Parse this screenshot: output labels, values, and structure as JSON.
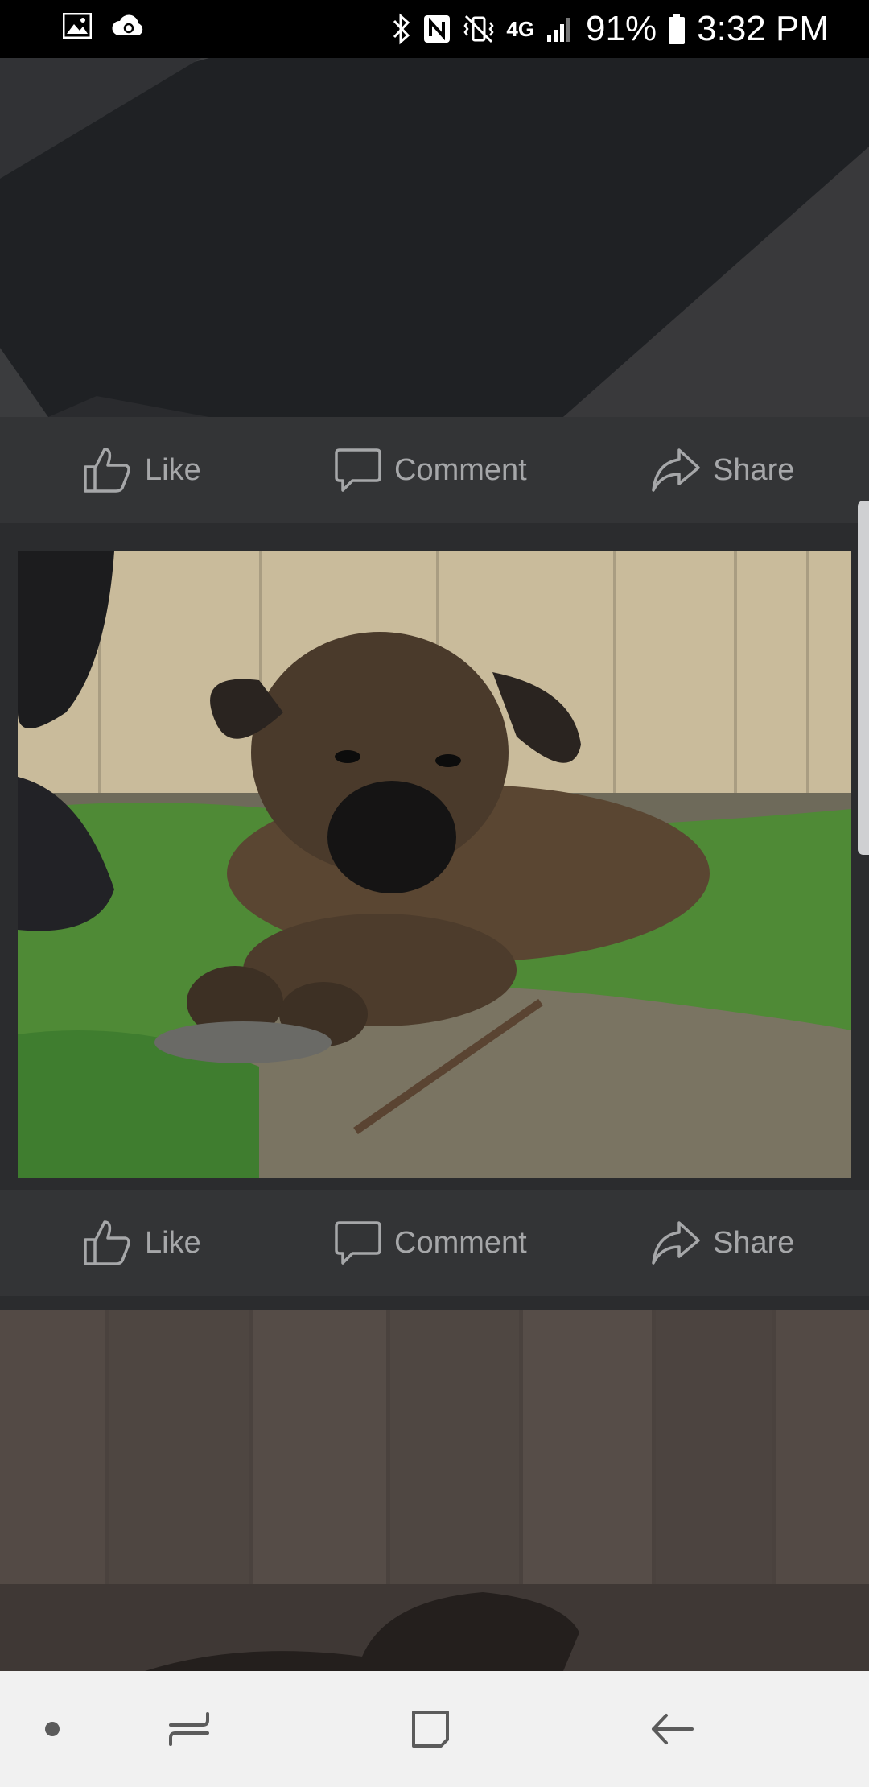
{
  "status_bar": {
    "battery_percent": "91%",
    "time": "3:32 PM",
    "network_label": "4G",
    "icons": [
      "gallery-icon",
      "cloud-sync-icon",
      "bluetooth-icon",
      "nfc-icon",
      "vibrate-mute-icon",
      "network-4g-icon",
      "signal-icon",
      "battery-icon"
    ]
  },
  "posts": [
    {
      "like_label": "Like",
      "comment_label": "Comment",
      "share_label": "Share"
    },
    {
      "like_label": "Like",
      "comment_label": "Comment",
      "share_label": "Share"
    }
  ],
  "navigation": {
    "icons": [
      "nav-dot-icon",
      "recent-apps-icon",
      "home-icon",
      "back-icon"
    ]
  },
  "colors": {
    "background": "#2b2c2e",
    "action_bar": "#333436",
    "action_text": "#a6a7a9",
    "nav_bar": "#f1f1f1",
    "nav_icon": "#5b5b5b"
  }
}
